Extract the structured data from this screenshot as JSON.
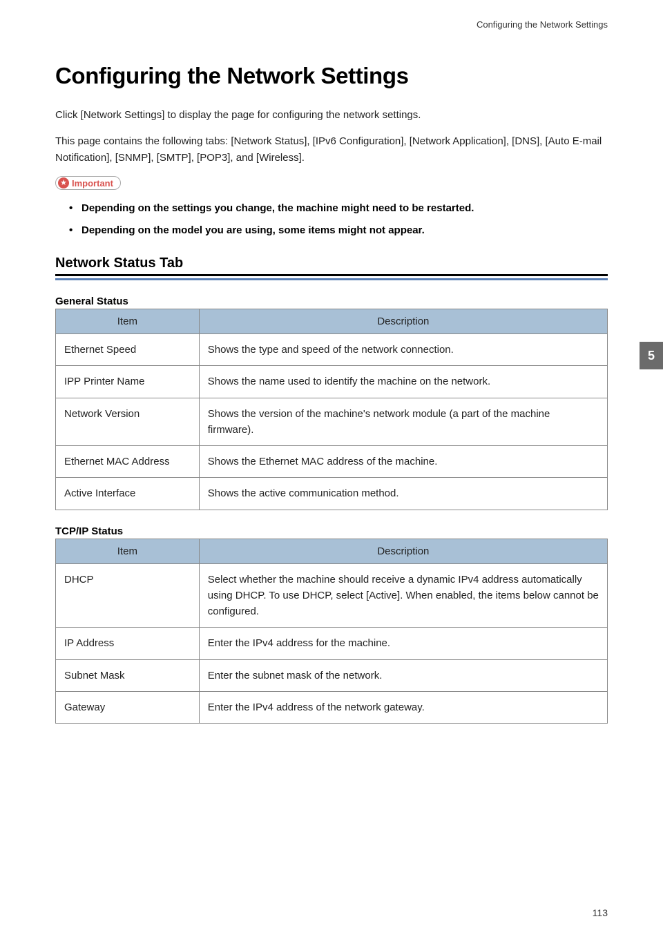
{
  "header": "Configuring the Network Settings",
  "title": "Configuring the Network Settings",
  "intro1": "Click [Network Settings] to display the page for configuring the network settings.",
  "intro2": "This page contains the following tabs: [Network Status], [IPv6 Configuration], [Network Application], [DNS], [Auto E-mail Notification], [SNMP], [SMTP], [POP3], and [Wireless].",
  "important_label": "Important",
  "bullets": {
    "b1": "Depending on the settings you change, the machine might need to be restarted.",
    "b2": "Depending on the model you are using, some items might not appear."
  },
  "section1_title": "Network Status Tab",
  "general_status_title": "General Status",
  "tcpip_status_title": "TCP/IP Status",
  "th_item": "Item",
  "th_description": "Description",
  "general_status": {
    "r1_item": "Ethernet Speed",
    "r1_desc": "Shows the type and speed of the network connection.",
    "r2_item": "IPP Printer Name",
    "r2_desc": "Shows the name used to identify the machine on the network.",
    "r3_item": "Network Version",
    "r3_desc": "Shows the version of the machine's network module (a part of the machine firmware).",
    "r4_item": "Ethernet MAC Address",
    "r4_desc": "Shows the Ethernet MAC address of the machine.",
    "r5_item": "Active Interface",
    "r5_desc": "Shows the active communication method."
  },
  "tcpip_status": {
    "r1_item": "DHCP",
    "r1_desc": "Select whether the machine should receive a dynamic IPv4 address automatically using DHCP. To use DHCP, select [Active]. When enabled, the items below cannot be configured.",
    "r2_item": "IP Address",
    "r2_desc": "Enter the IPv4 address for the machine.",
    "r3_item": "Subnet Mask",
    "r3_desc": "Enter the subnet mask of the network.",
    "r4_item": "Gateway",
    "r4_desc": "Enter the IPv4 address of the network gateway."
  },
  "side_tab": "5",
  "page_number": "113"
}
